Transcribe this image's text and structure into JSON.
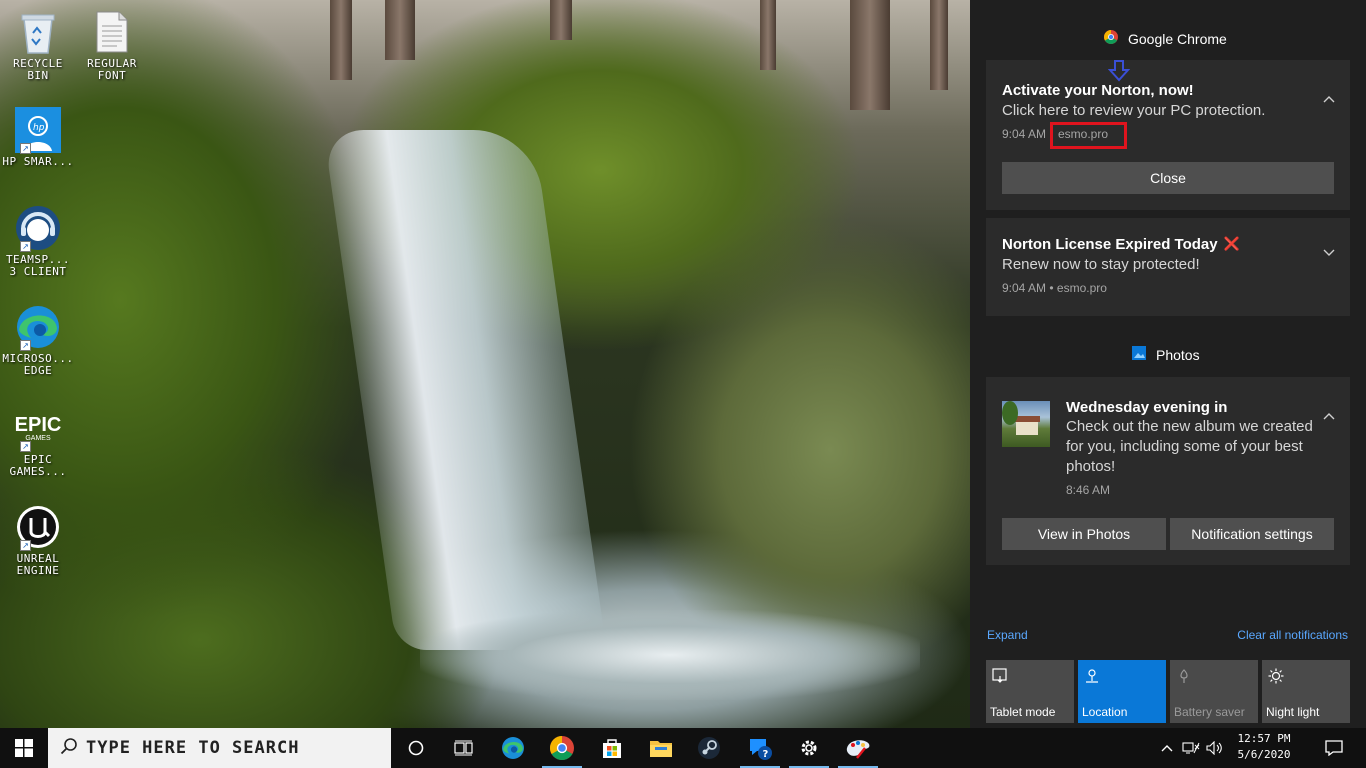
{
  "desktop": {
    "icons": [
      {
        "label": "RECYCLE BIN",
        "icon": "recycle-bin-icon"
      },
      {
        "label": "REGULAR FONT",
        "icon": "font-file-icon"
      },
      {
        "label": "HP SMAR...",
        "icon": "hp-smart-icon"
      },
      {
        "label": "TEAMSP... 3 CLIENT",
        "icon": "teamspeak-icon"
      },
      {
        "label": "MICROSO... EDGE",
        "icon": "edge-icon"
      },
      {
        "label": "EPIC GAMES...",
        "icon": "epic-games-icon",
        "logo_text": "EPIC",
        "logo_sub": "GAMES"
      },
      {
        "label": "UNREAL ENGINE",
        "icon": "unreal-engine-icon"
      }
    ]
  },
  "action_center": {
    "groups": [
      {
        "app": "Google Chrome",
        "icon": "chrome-icon",
        "notifications": [
          {
            "title": "Activate your Norton, now!",
            "body": "Click here to review your PC protection.",
            "time": "9:04 AM",
            "source": "esmo.pro",
            "expanded": true,
            "button": "Close"
          },
          {
            "title": "Norton License Expired Today",
            "title_mark": "❌",
            "body": "Renew now to stay protected!",
            "meta": "9:04 AM • esmo.pro",
            "expanded": false
          }
        ]
      },
      {
        "app": "Photos",
        "icon": "photos-icon",
        "notifications": [
          {
            "title": "Wednesday evening in",
            "body": "Check out the new album we created for you, including some of your best photos!",
            "time": "8:46 AM",
            "buttons": [
              "View in Photos",
              "Notification settings"
            ]
          }
        ]
      }
    ],
    "expand_label": "Expand",
    "clear_label": "Clear all notifications",
    "quick_actions": [
      {
        "label": "Tablet mode",
        "icon": "tablet-mode-icon",
        "state": "off"
      },
      {
        "label": "Location",
        "icon": "location-icon",
        "state": "on"
      },
      {
        "label": "Battery saver",
        "icon": "battery-saver-icon",
        "state": "disabled"
      },
      {
        "label": "Night light",
        "icon": "night-light-icon",
        "state": "off"
      }
    ],
    "annotation_color": "#e0141e",
    "arrow_color": "#3a4fd6",
    "accent": "#0a78d7"
  },
  "taskbar": {
    "search_placeholder": "TYPE HERE TO SEARCH",
    "apps": [
      "cortana-icon",
      "task-view-icon",
      "edge-icon",
      "chrome-icon",
      "store-icon",
      "file-explorer-icon",
      "steam-icon",
      "get-help-icon",
      "settings-icon",
      "paint-3d-icon"
    ],
    "clock": {
      "time": "12:57 PM",
      "date": "5/6/2020"
    }
  }
}
